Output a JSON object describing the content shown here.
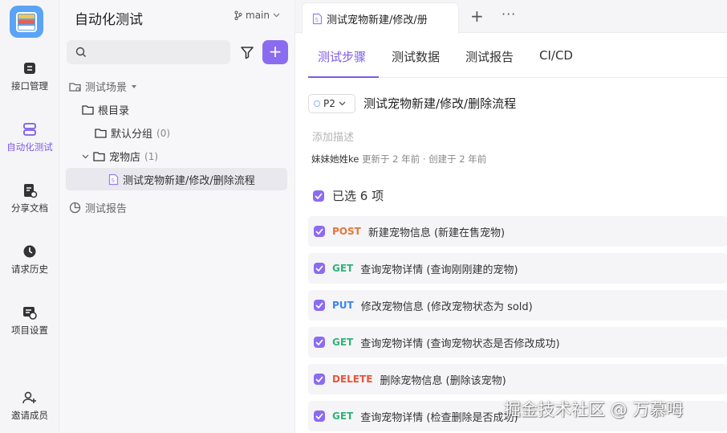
{
  "nav": {
    "items": [
      {
        "label": "接口管理",
        "icon": "api-icon"
      },
      {
        "label": "自动化测试",
        "icon": "automation-icon"
      },
      {
        "label": "分享文档",
        "icon": "share-doc-icon"
      },
      {
        "label": "请求历史",
        "icon": "history-icon"
      },
      {
        "label": "项目设置",
        "icon": "settings-icon"
      },
      {
        "label": "邀请成员",
        "icon": "invite-icon"
      }
    ]
  },
  "tree": {
    "title": "自动化测试",
    "branch": "main",
    "nodes": {
      "scenes": "测试场景",
      "root": "根目录",
      "default_group": "默认分组",
      "default_count": "(0)",
      "petstore": "宠物店",
      "petstore_count": "(1)",
      "case": "测试宠物新建/修改/删除流程",
      "reports": "测试报告"
    }
  },
  "tabs": {
    "doc_tab": "测试宠物新建/修改/册",
    "plus": "+",
    "more": "···"
  },
  "subtabs": [
    "测试步骤",
    "测试数据",
    "测试报告",
    "CI/CD"
  ],
  "case": {
    "priority": "P2",
    "title": "测试宠物新建/修改/删除流程",
    "desc_placeholder": "添加描述",
    "author": "妹妹她姓ke",
    "updated": "更新于 2 年前 · 创建于 2 年前",
    "selected": "已选 6 项"
  },
  "steps": [
    {
      "method": "POST",
      "name": "新建宠物信息 (新建在售宠物)",
      "color": "#e8743b"
    },
    {
      "method": "GET",
      "name": "查询宠物详情 (查询刚刚建的宠物)",
      "color": "#2fb37a"
    },
    {
      "method": "PUT",
      "name": "修改宠物信息 (修改宠物状态为 sold)",
      "color": "#3a84f0"
    },
    {
      "method": "GET",
      "name": "查询宠物详情 (查询宠物状态是否修改成功)",
      "color": "#2fb37a"
    },
    {
      "method": "DELETE",
      "name": "删除宠物信息 (删除该宠物)",
      "color": "#e8543b"
    },
    {
      "method": "GET",
      "name": "查询宠物详情 (检查删除是否成功)",
      "color": "#2fb37a"
    }
  ],
  "watermark": "掘金技术社区 @ 万慕呣",
  "colors": {
    "accent": "#7b5be8"
  }
}
